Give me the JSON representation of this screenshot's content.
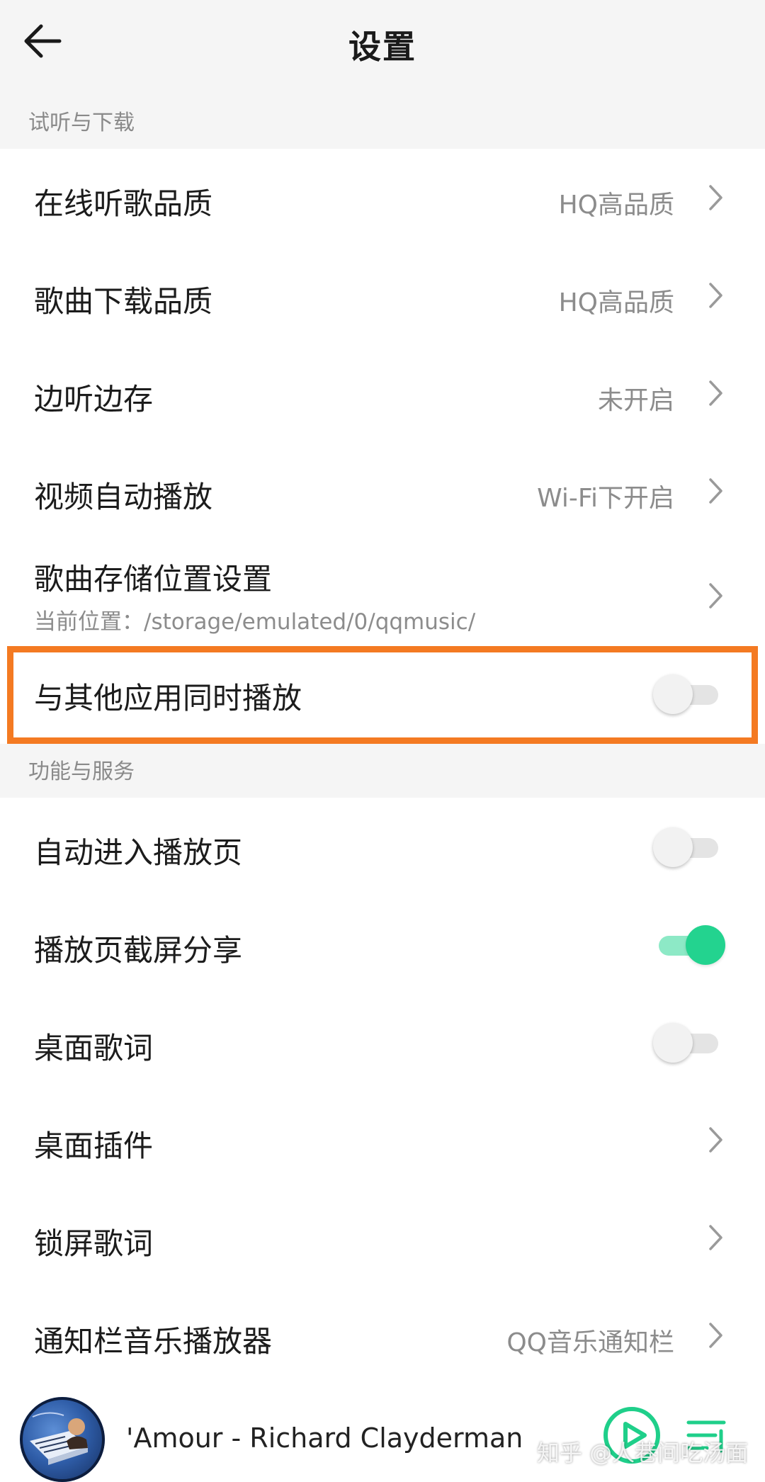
{
  "header": {
    "title": "设置",
    "back_icon": "back-arrow-icon"
  },
  "section1": {
    "label": "试听与下载",
    "items": [
      {
        "label": "在线听歌品质",
        "value": "HQ高品质"
      },
      {
        "label": "歌曲下载品质",
        "value": "HQ高品质"
      },
      {
        "label": "边听边存",
        "value": "未开启"
      },
      {
        "label": "视频自动播放",
        "value": "Wi-Fi下开启"
      },
      {
        "label": "歌曲存储位置设置",
        "sub": "当前位置：/storage/emulated/0/qqmusic/"
      },
      {
        "label": "与其他应用同时播放",
        "toggle": false
      }
    ]
  },
  "section2": {
    "label": "功能与服务",
    "items": [
      {
        "label": "自动进入播放页",
        "toggle": false
      },
      {
        "label": "播放页截屏分享",
        "toggle": true
      },
      {
        "label": "桌面歌词",
        "toggle": false
      },
      {
        "label": "桌面插件"
      },
      {
        "label": "锁屏歌词"
      },
      {
        "label": "通知栏音乐播放器",
        "value": "QQ音乐通知栏"
      }
    ]
  },
  "player": {
    "song": "'Amour - Richard Clayderman",
    "play_icon": "play-icon",
    "playlist_icon": "playlist-icon"
  },
  "watermark": "知乎 @人巷间吃汤面",
  "colors": {
    "accent_green": "#23d38f",
    "highlight_orange": "#f47a22"
  }
}
